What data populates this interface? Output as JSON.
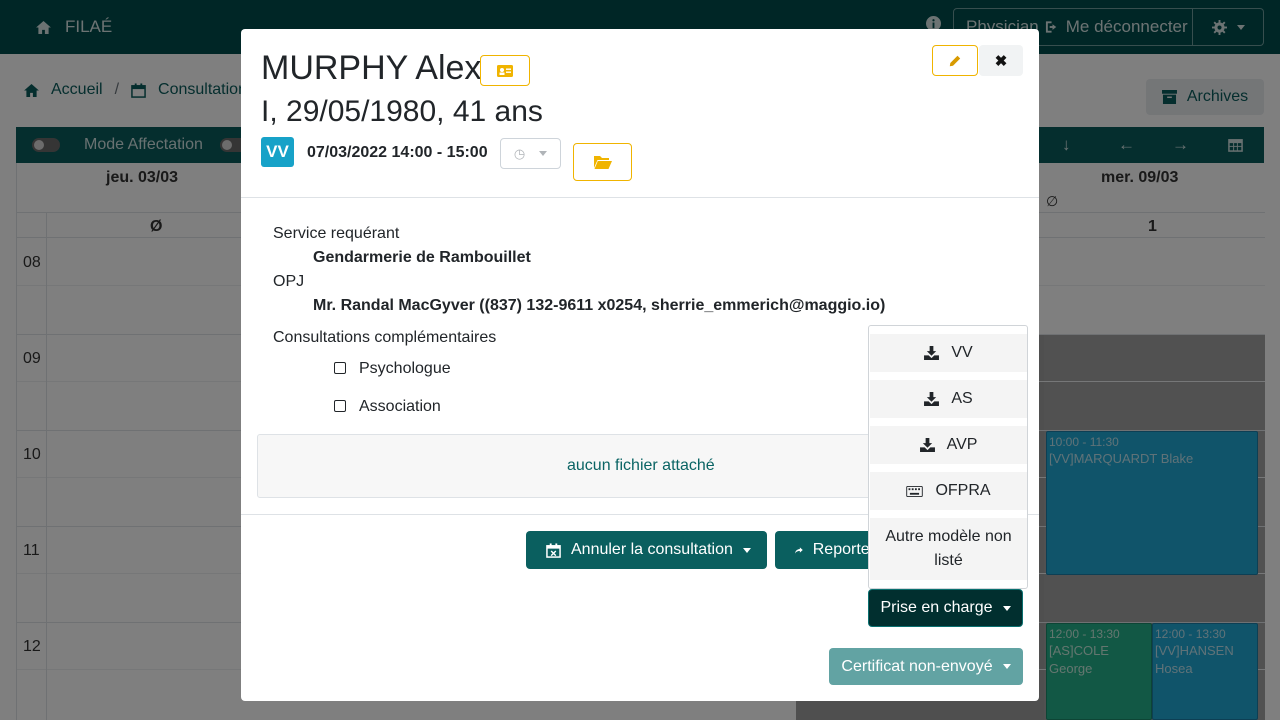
{
  "navbar": {
    "brand": "FILAÉ",
    "user_label": "Physician",
    "logout_label": "Me déconnecter",
    "icons": {
      "home": "home-icon",
      "info": "info-icon",
      "logout": "sign-out-icon",
      "settings": "gear-icon"
    },
    "color": "#004d4d"
  },
  "breadcrumb": {
    "home": "Accueil",
    "separator": "/",
    "current": "Consultations"
  },
  "archives_label": "Archives",
  "toolbar": {
    "mode_affectation": "Mode Affectation"
  },
  "calendar": {
    "days": [
      {
        "label": "jeu. 03/03",
        "sub": "Ø"
      },
      {
        "label": "mer. 09/03",
        "sub": "∅",
        "count": "1"
      }
    ],
    "hours": [
      "08",
      "09",
      "10",
      "11",
      "12"
    ],
    "events": [
      {
        "time": "10:00 - 11:30",
        "title": "[VV]MARQUARDT Blake"
      },
      {
        "time": "12:00 - 13:30",
        "title": "[AS]COLE George"
      },
      {
        "time": "12:00 - 13:30",
        "title": "[VV]HANSEN Hosea"
      }
    ]
  },
  "modal": {
    "patient_name": "MURPHY Alex",
    "patient_info": "I, 29/05/1980, 41 ans",
    "type_badge": "VV",
    "date_range": "07/03/2022 14:00 - 15:00",
    "service_label": "Service requérant",
    "service_value": "Gendarmerie de Rambouillet",
    "opj_label": "OPJ",
    "opj_value": "Mr. Randal MacGyver ((837) 132-9611 x0254, sherrie_emmerich@maggio.io)",
    "complementary_label": "Consultations complémentaires",
    "complementary_options": [
      "Psychologue",
      "Association"
    ],
    "files_text": "aucun fichier attaché",
    "cancel_label": "Annuler la consultation",
    "report_label": "Reporter",
    "prise_label": "Prise en charge",
    "certificate_label": "Certificat non-envoyé",
    "dropdown_items": [
      {
        "label": "VV",
        "icon": "download-icon"
      },
      {
        "label": "AS",
        "icon": "download-icon"
      },
      {
        "label": "AVP",
        "icon": "download-icon"
      },
      {
        "label": "OFPRA",
        "icon": "keyboard-icon"
      },
      {
        "label": "Autre modèle non listé",
        "icon": ""
      }
    ],
    "colors": {
      "warning": "#f0b400",
      "info": "#17a2c8",
      "primary": "#0a5f5f"
    }
  }
}
